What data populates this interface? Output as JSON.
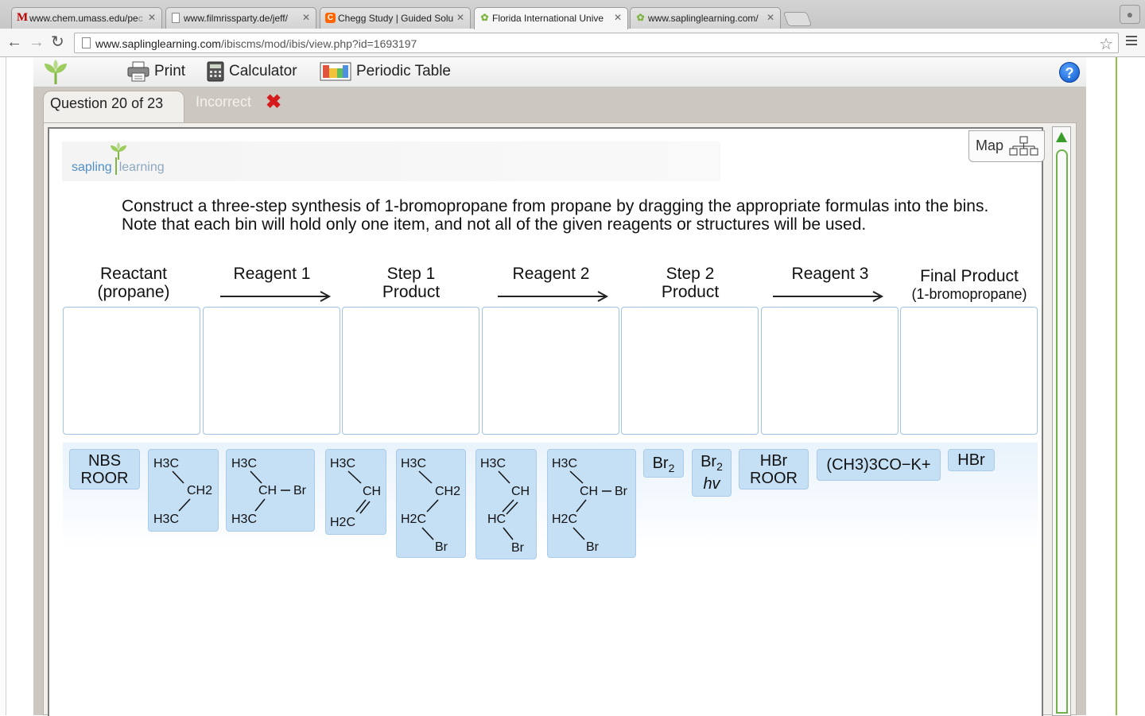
{
  "browser": {
    "tabs": [
      {
        "label": "www.chem.umass.edu/pe",
        "fade": "c",
        "favicon": "M"
      },
      {
        "label": "www.filmrissparty.de/jeff/",
        "fade": "",
        "favicon": "doc-icon"
      },
      {
        "label": "Chegg Study | Guided Solu",
        "fade": "",
        "favicon": "C"
      },
      {
        "label": "Florida International Unive",
        "fade": "",
        "favicon": "leaf-icon"
      },
      {
        "label": "www.saplinglearning.com/",
        "fade": "",
        "favicon": "leaf-icon"
      }
    ],
    "url_host": "www.saplinglearning.com",
    "url_path": "/ibiscms/mod/ibis/view.php?id=1693197"
  },
  "app": {
    "print_label": "Print",
    "calculator_label": "Calculator",
    "periodic_label": "Periodic Table",
    "help_label": "?",
    "question_label": "Question 20 of 23",
    "status_label": "Incorrect",
    "map_label": "Map",
    "logo_word1": "sapling",
    "logo_word2": "learning"
  },
  "question": {
    "instructions": "Construct a three-step synthesis of 1-bromopropane from propane by dragging the appropriate formulas into the bins. Note that each bin will hold only one item, and not all of the given reagents or structures will be used.",
    "columns": [
      {
        "line1": "Reactant",
        "line2": "(propane)",
        "arrow": false
      },
      {
        "line1": "Reagent 1",
        "line2": "",
        "arrow": true
      },
      {
        "line1": "Step 1",
        "line2": "Product",
        "arrow": false
      },
      {
        "line1": "Reagent 2",
        "line2": "",
        "arrow": true
      },
      {
        "line1": "Step 2",
        "line2": "Product",
        "arrow": false
      },
      {
        "line1": "Reagent 3",
        "line2": "",
        "arrow": true
      },
      {
        "line1": "Final Product",
        "line2": "(1-bromopropane)",
        "arrow": false
      }
    ]
  },
  "choices": {
    "nbs_roor": [
      "NBS",
      "ROOR"
    ],
    "br2": "Br",
    "br2_hv": [
      "Br",
      "hv"
    ],
    "hbr_roor": [
      "HBr",
      "ROOR"
    ],
    "tbuok": "(CH3)3CO−K+",
    "hbr": "HBr",
    "structures": [
      {
        "name": "propane",
        "atoms": [
          "H3C",
          "CH2",
          "H3C"
        ]
      },
      {
        "name": "2-bromopropane",
        "atoms": [
          "H3C",
          "CH",
          "Br",
          "H3C"
        ]
      },
      {
        "name": "propene",
        "atoms": [
          "H3C",
          "CH",
          "H2C"
        ]
      },
      {
        "name": "1-bromopropane",
        "atoms": [
          "H3C",
          "CH2",
          "H2C",
          "Br"
        ]
      },
      {
        "name": "1-bromopropene",
        "atoms": [
          "H3C",
          "CH",
          "HC",
          "Br"
        ]
      },
      {
        "name": "1,2-dibromopropane",
        "atoms": [
          "H3C",
          "CH",
          "Br",
          "H2C",
          "Br"
        ]
      }
    ]
  }
}
